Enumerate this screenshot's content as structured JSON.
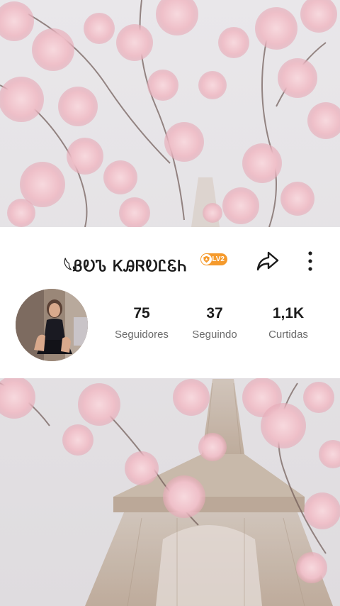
{
  "profile": {
    "username": "𓆩ᏰᎧᏖ ᏦᎯᏒᎧᏝᏋᏂ",
    "level_badge": "LV2",
    "avatar_alt": "avatar"
  },
  "stats": [
    {
      "value": "75",
      "label": "Seguidores"
    },
    {
      "value": "37",
      "label": "Seguindo"
    },
    {
      "value": "1,1K",
      "label": "Curtidas"
    }
  ],
  "colors": {
    "badge": "#f59a2c",
    "card": "#ffffff",
    "text": "#1c1c1c",
    "muted": "#6b6b6b",
    "blossom": "#f2c6cf"
  },
  "icons": {
    "share": "share-arrow-icon",
    "more": "more-vertical-icon",
    "level": "level-shield-icon"
  }
}
